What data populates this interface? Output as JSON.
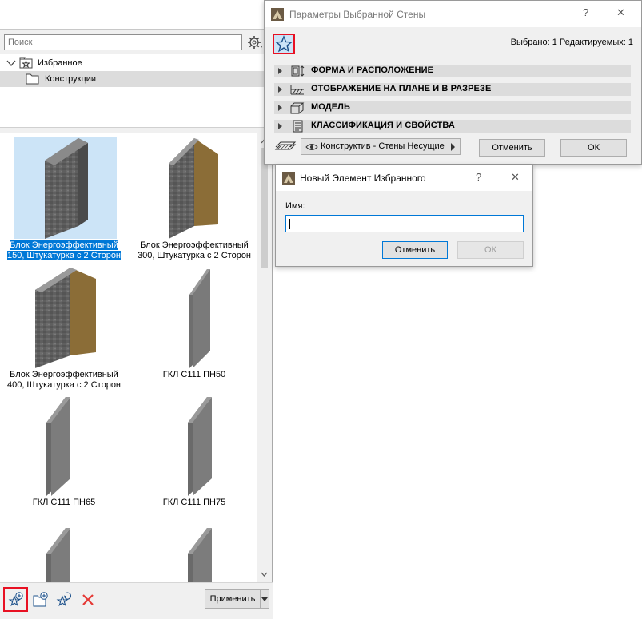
{
  "favorites": {
    "search_placeholder": "Поиск",
    "tree": [
      {
        "label": "Избранное",
        "icon": "star-folder-icon"
      },
      {
        "label": "Конструкции",
        "icon": "folder-icon"
      }
    ],
    "items": [
      {
        "line1": "Блок Энергоэффективный",
        "line2": "150, Штукатурка с 2 Сторон",
        "selected": true
      },
      {
        "line1": "Блок Энергоэффективный",
        "line2": "300, Штукатурка с 2 Сторон",
        "selected": false
      },
      {
        "line1": "Блок Энергоэффективный",
        "line2": "400, Штукатурка с 2 Сторон",
        "selected": false
      },
      {
        "line1": "ГКЛ С111 ПН50",
        "line2": "",
        "selected": false
      },
      {
        "line1": "ГКЛ С111 ПН65",
        "line2": "",
        "selected": false
      },
      {
        "line1": "ГКЛ С111 ПН75",
        "line2": "",
        "selected": false
      }
    ],
    "apply_label": "Применить",
    "bottom_icons": [
      "new-favorite-icon",
      "new-folder-icon",
      "redefine-favorite-icon",
      "delete-icon"
    ]
  },
  "wall_dialog": {
    "title": "Параметры Выбранной Стены",
    "selected_info": "Выбрано: 1 Редактируемых: 1",
    "sections": [
      {
        "label": "ФОРМА И РАСПОЛОЖЕНИЕ",
        "icon": "shape-position-icon"
      },
      {
        "label": "ОТОБРАЖЕНИЕ НА ПЛАНЕ И В РАЗРЕЗЕ",
        "icon": "floor-plan-icon"
      },
      {
        "label": "МОДЕЛЬ",
        "icon": "model-icon"
      },
      {
        "label": "КЛАССИФИКАЦИЯ И СВОЙСТВА",
        "icon": "classification-icon"
      }
    ],
    "layer_value": "Конструктив - Стены Несущие",
    "cancel_label": "Отменить",
    "ok_label": "ОК",
    "help_glyph": "?",
    "close_glyph": "✕"
  },
  "new_favorite_dialog": {
    "title": "Новый Элемент Избранного",
    "name_label": "Имя:",
    "name_value": "",
    "cancel_label": "Отменить",
    "ok_label": "ОК",
    "help_glyph": "?",
    "close_glyph": "✕"
  },
  "colors": {
    "highlight": "#e81123",
    "selection": "#0078d7",
    "selection_light": "#cce4f7"
  }
}
